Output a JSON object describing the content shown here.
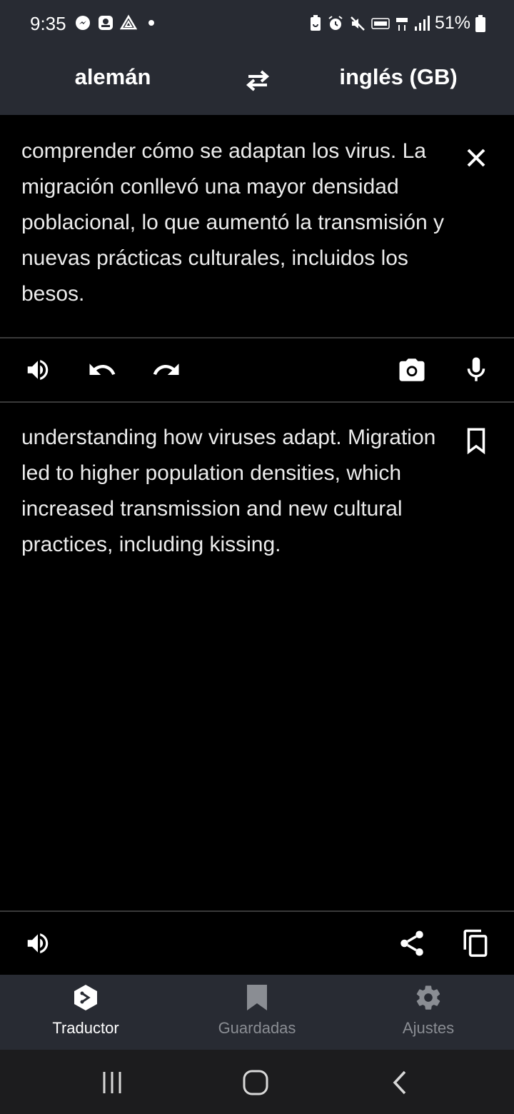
{
  "status_bar": {
    "time": "9:35",
    "battery": "51%",
    "left_icons": [
      "messenger-icon",
      "app-icon",
      "drive-icon",
      "dot-icon"
    ],
    "right_icons": [
      "battery-saver-icon",
      "alarm-icon",
      "mute-icon",
      "volte-icon",
      "4g-icon",
      "signal-icon",
      "battery-icon"
    ]
  },
  "language_bar": {
    "source_language": "alemán",
    "target_language": "inglés (GB)"
  },
  "source": {
    "text": "comprender cómo se adaptan los virus. La migración conllevó una mayor densidad poblacional, lo que aumentó la transmisión y nuevas prácticas culturales, incluidos los besos."
  },
  "target": {
    "text": "understanding how viruses adapt. Migration led to higher population densities, which increased transmission and new cultural practices, including kissing."
  },
  "bottom_nav": {
    "items": [
      {
        "label": "Traductor",
        "icon": "translator-icon",
        "active": true
      },
      {
        "label": "Guardadas",
        "icon": "bookmark-icon",
        "active": false
      },
      {
        "label": "Ajustes",
        "icon": "gear-icon",
        "active": false
      }
    ]
  },
  "colors": {
    "background": "#000000",
    "bar": "#282b33",
    "text": "#ececec",
    "inactive_nav": "#8a8d93"
  }
}
